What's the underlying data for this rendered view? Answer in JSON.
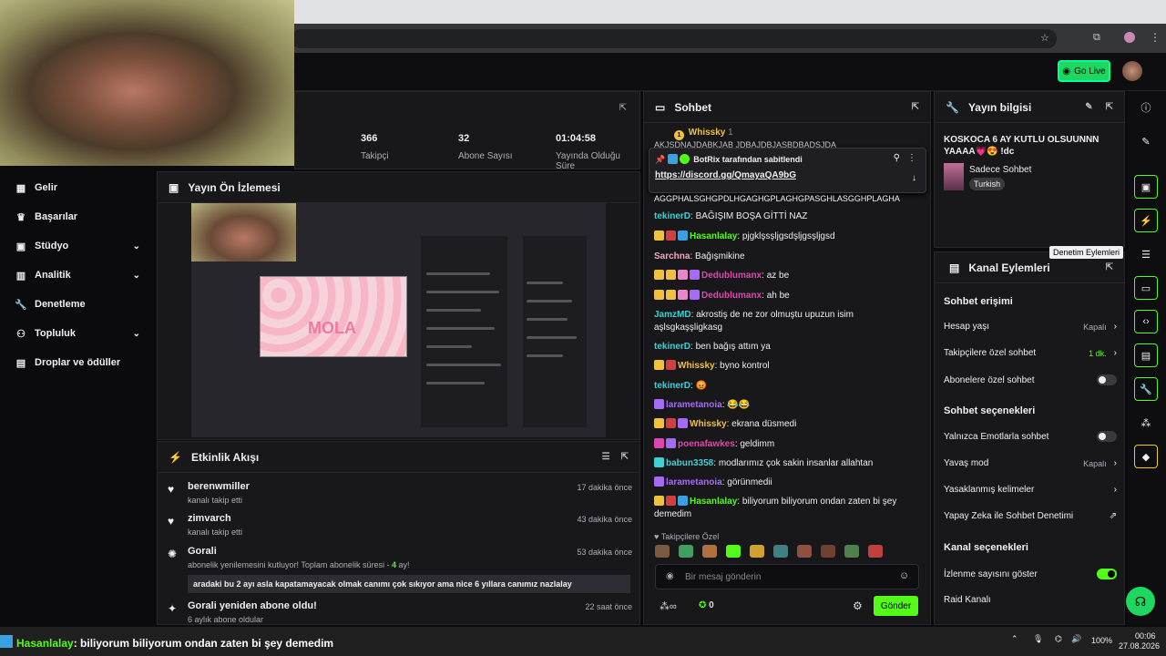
{
  "browser": {
    "golive": "Go Live"
  },
  "nav": [
    {
      "label": "Gelir",
      "icon": "wallet-icon",
      "chev": false
    },
    {
      "label": "Başarılar",
      "icon": "trophy-icon",
      "chev": false
    },
    {
      "label": "Stüdyo",
      "icon": "studio-icon",
      "chev": true
    },
    {
      "label": "Analitik",
      "icon": "analytics-icon",
      "chev": true
    },
    {
      "label": "Denetleme",
      "icon": "wrench-icon",
      "chev": false
    },
    {
      "label": "Topluluk",
      "icon": "community-icon",
      "chev": true
    },
    {
      "label": "Droplar ve ödüller",
      "icon": "gift-icon",
      "chev": false
    }
  ],
  "stats": [
    {
      "value": "366",
      "label": "Takipçi"
    },
    {
      "value": "32",
      "label": "Abone Sayısı"
    },
    {
      "value": "01:04:58",
      "label": "Yayında Olduğu Süre"
    }
  ],
  "preview": {
    "title": "Yayın Ön İzlemesi",
    "mola": "MOLA"
  },
  "activity": {
    "title": "Etkinlik Akışı",
    "items": [
      {
        "name": "berenwmiller",
        "sub": "kanalı takip etti",
        "time": "17 dakika önce",
        "icon": "heart-icon"
      },
      {
        "name": "zimvarch",
        "sub": "kanalı takip etti",
        "time": "43 dakika önce",
        "icon": "heart-icon"
      },
      {
        "name": "Gorali",
        "sub": "abonelik yenilemesini kutluyor! Toplam abonelik süresi - ",
        "months": "4",
        "months_suffix": " ay!",
        "quote": "aradaki bu 2 ayı asla kapatamayacak olmak canımı çok sıkıyor ama nice 6 yıllara canımız nazlalay",
        "time": "53 dakika önce",
        "icon": "party-icon"
      },
      {
        "name": "Gorali yeniden abone oldu!",
        "sub": "6 aylık abone oldular",
        "time": "22 saat önce",
        "icon": "sparkle-icon"
      }
    ]
  },
  "chat": {
    "title": "Sohbet",
    "top_user": "Whissky",
    "top_count": "1",
    "top_text": "AKJSDNAJDABKJAB JDBAJDBJASBDBADSJDA",
    "pin_by": "BotRix",
    "pin_label": "tarafından sabitlendi",
    "pin_link": "https://discord.gg/QmayaQA9bG",
    "overflow_text": "AGGPHALSGHGPDLHGAGHGPLAGHGPASGHLASGGHPLAGHA",
    "messages": [
      {
        "user": "tekinerD",
        "color": "#3fd0d4",
        "text": "BAĞIŞIM BOŞA GİTTİ NAZ",
        "badges": []
      },
      {
        "user": "Hasanlalay",
        "color": "#53fc18",
        "text": "pjgklşsşljgsdşljgsşljgsd",
        "badges": [
          "#f0c040",
          "#d04040",
          "#3aa0e0"
        ]
      },
      {
        "user": "Sarchna",
        "color": "#f4a7c3",
        "text": "Bağışmikine",
        "badges": []
      },
      {
        "user": "Dedublumanx",
        "color": "#e046b0",
        "text": "az be",
        "badges": [
          "#f0c040",
          "#f0c040",
          "#e887c8",
          "#a56bf4"
        ]
      },
      {
        "user": "Dedublumanx",
        "color": "#e046b0",
        "text": "ah be",
        "badges": [
          "#f0c040",
          "#f0c040",
          "#e887c8",
          "#a56bf4"
        ]
      },
      {
        "user": "JamzMD",
        "color": "#3fd0d4",
        "text": "akrostiş de ne zor olmuştu upuzun isim aşlsgkaşşligkasg",
        "badges": []
      },
      {
        "user": "tekinerD",
        "color": "#3fd0d4",
        "text": "ben bağış attım ya",
        "badges": []
      },
      {
        "user": "Whissky",
        "color": "#f0c040",
        "text": "byno kontrol",
        "badges": [
          "#f0c040",
          "#d04040"
        ]
      },
      {
        "user": "tekinerD",
        "color": "#3fd0d4",
        "text": "😡",
        "badges": []
      },
      {
        "user": "larametanoia",
        "color": "#a56bf4",
        "text": "😂😂",
        "badges": [
          "#a56bf4"
        ]
      },
      {
        "user": "Whissky",
        "color": "#f0c040",
        "text": "ekrana düsmedi",
        "badges": [
          "#f0c040",
          "#d04040",
          "#a56bf4"
        ]
      },
      {
        "user": "poenafawkes",
        "color": "#e046b0",
        "text": "geldimm",
        "badges": [
          "#e046b0",
          "#a56bf4"
        ]
      },
      {
        "user": "babun3358",
        "color": "#3fd0d4",
        "text": "modlarımız çok sakin insanlar allahtan",
        "badges": [
          "#3fd0d4"
        ]
      },
      {
        "user": "larametanoia",
        "color": "#a56bf4",
        "text": "görünmedii",
        "badges": [
          "#a56bf4"
        ]
      },
      {
        "user": "Hasanlalay",
        "color": "#53fc18",
        "text": "biliyorum biliyorum ondan zaten bi şey demedim",
        "badges": [
          "#f0c040",
          "#d04040",
          "#3aa0e0"
        ]
      }
    ],
    "followers_only": "Takipçilere Özel",
    "input_placeholder": "Bir mesaj gönderin",
    "viewers": "0",
    "send": "Gönder"
  },
  "stream_info": {
    "title": "Yayın bilgisi",
    "stream_title": "KOSKOCA 6 AY KUTLU OLSUUNNN YAAAA💗😍 !dc",
    "category": "Sadece Sohbet",
    "tag": "Turkish"
  },
  "actions": {
    "title": "Kanal Eylemleri",
    "tooltip": "Denetim Eylemleri",
    "sec1": "Sohbet erişimi",
    "account_age": "Hesap yaşı",
    "account_age_val": "Kapalı",
    "followers_chat": "Takipçilere özel sohbet",
    "followers_chat_val": "1 dk.",
    "subs_chat": "Abonelere özel sohbet",
    "sec2": "Sohbet seçenekleri",
    "emote_only": "Yalnızca Emotlarla sohbet",
    "slow_mode": "Yavaş mod",
    "slow_mode_val": "Kapalı",
    "banned_words": "Yasaklanmış kelimeler",
    "ai_mod": "Yapay Zeka ile Sohbet Denetimi",
    "sec3": "Kanal seçenekleri",
    "show_viewers": "İzlenme sayısını göster",
    "raid": "Raid Kanalı"
  },
  "ticker": {
    "user": "Hasanlalay",
    "text": ": biliyorum biliyorum ondan zaten bi şey demedim"
  },
  "tray": {
    "battery": "100%",
    "time": "00:06",
    "date": "27.08.2026"
  },
  "colors": {
    "accent": "#53fc18",
    "bg": "#0e0e10",
    "panel": "#18181b"
  }
}
